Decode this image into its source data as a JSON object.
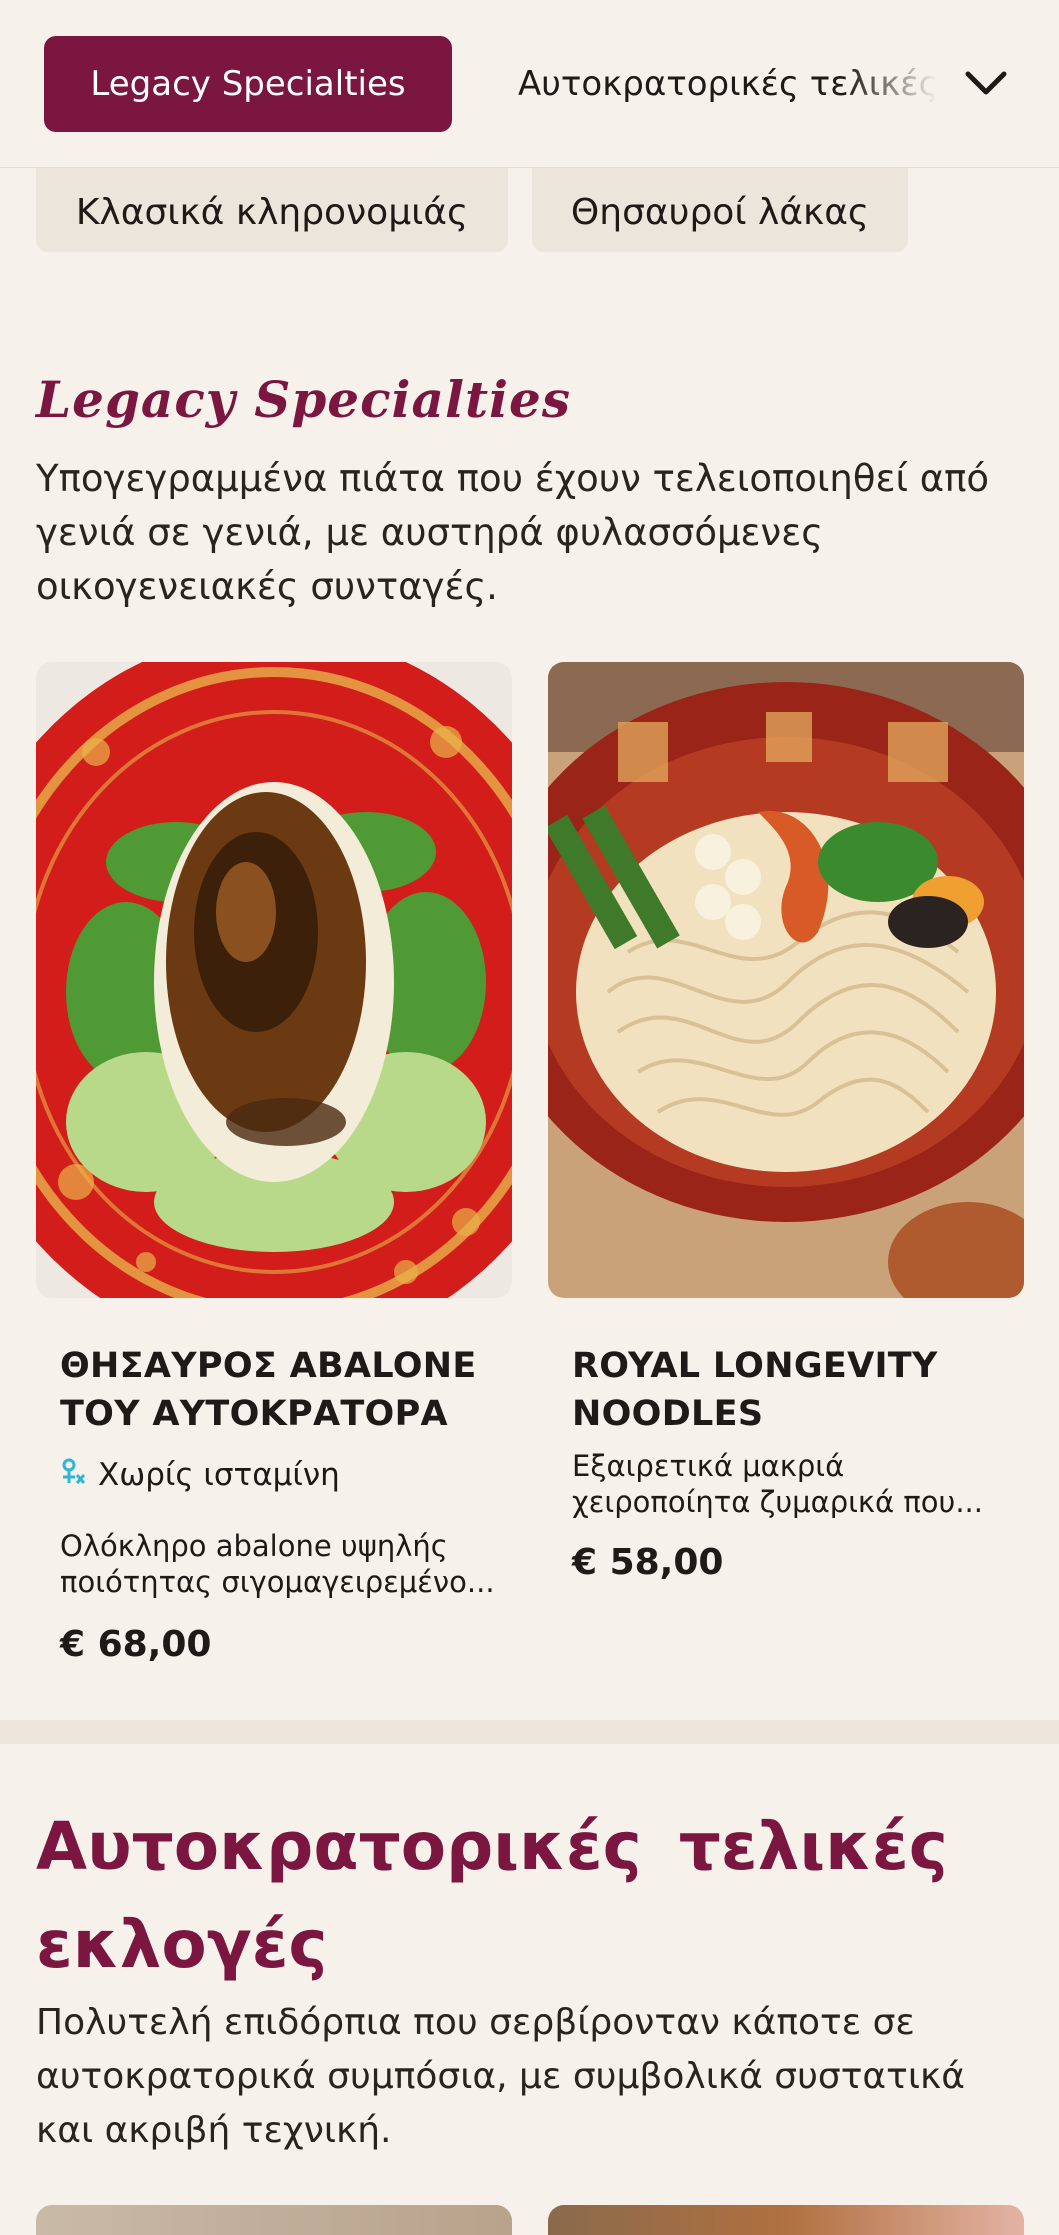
{
  "topbar": {
    "active_category": "Legacy Specialties",
    "next_category": "Αυτοκρατορικές τελικές"
  },
  "chips": [
    "Κλασικά κληρονομιάς",
    "Θησαυροί λάκας"
  ],
  "section1": {
    "title": "Legacy Specialties",
    "description": "Υπογεγραμμένα πιάτα που έχουν τελειοποιηθεί από γενιά σε γενιά, με αυστηρά φυλασσόμενες οικογενειακές συνταγές."
  },
  "items": [
    {
      "name": "ΘΗΣΑΥΡΟΣ ABALONE ΤΟΥ ΑΥΤΟΚΡΑΤΟΡΑ",
      "allergen": "Χωρίς ισταμίνη",
      "description": "Ολόκληρο abalone υψηλής ποιότητας σιγομαγειρεμένο...",
      "price": "€ 68,00"
    },
    {
      "name": "ROYAL LONGEVITY NOODLES",
      "description": "Εξαιρετικά μακριά χειροποίητα ζυμαρικά που...",
      "price": "€ 58,00"
    }
  ],
  "section2": {
    "title": "Αυτοκρατορικές τελικές εκλογές",
    "description": "Πολυτελή επιδόρπια που σερβίρονταν κάποτε σε αυτοκρατορικά συμπόσια, με συμβολικά συστατικά και ακριβή τεχνική."
  },
  "colors": {
    "accent": "#7a1640",
    "background": "#f6f1ea",
    "chip": "#ece5dc",
    "allergen_icon": "#2fb6d6"
  },
  "icons": {
    "dropdown": "chevron-down-icon",
    "allergen": "histamine-free-icon"
  }
}
